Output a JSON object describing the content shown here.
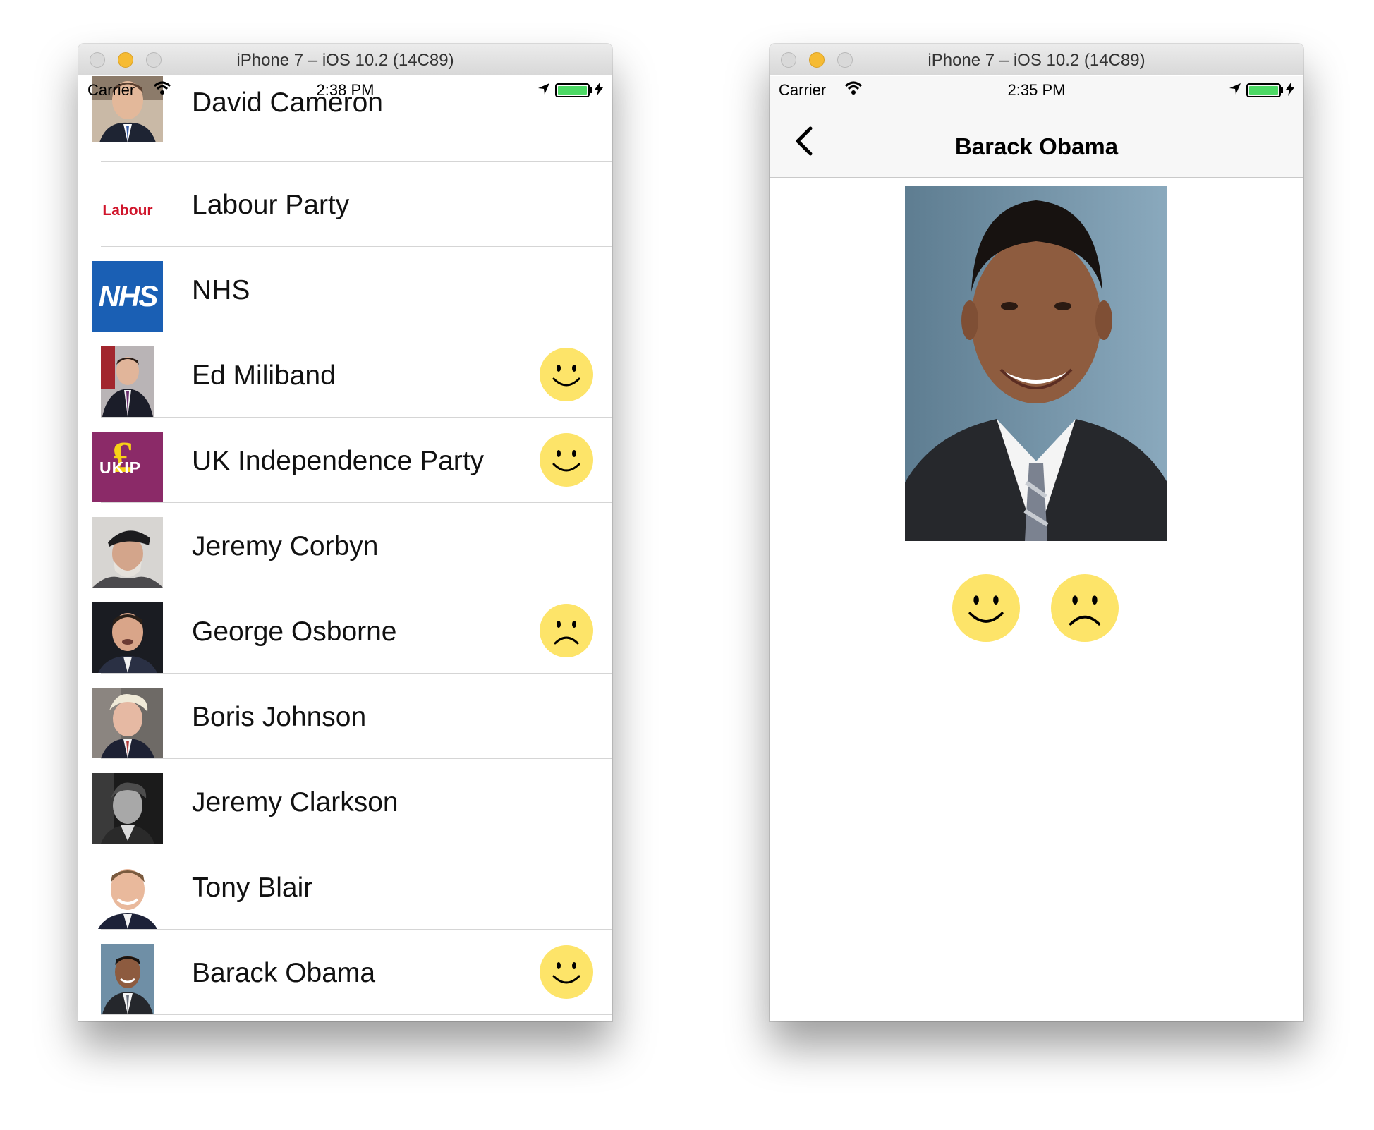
{
  "left_window": {
    "title": "iPhone 7 – iOS 10.2 (14C89)",
    "status": {
      "carrier": "Carrier",
      "time": "2:38 PM"
    },
    "rows": [
      {
        "name": "David Cameron",
        "thumb": "photo",
        "reaction": ""
      },
      {
        "name": "Labour Party",
        "thumb": "labour-logo",
        "logo_text": "Labour",
        "reaction": ""
      },
      {
        "name": "NHS",
        "thumb": "nhs-logo",
        "logo_text": "NHS",
        "reaction": ""
      },
      {
        "name": "Ed Miliband",
        "thumb": "photo",
        "reaction": "happy"
      },
      {
        "name": "UK Independence Party",
        "thumb": "ukip-logo",
        "logo_text": "UKIP",
        "reaction": "happy"
      },
      {
        "name": "Jeremy Corbyn",
        "thumb": "photo",
        "reaction": ""
      },
      {
        "name": "George Osborne",
        "thumb": "photo",
        "reaction": "sad"
      },
      {
        "name": "Boris Johnson",
        "thumb": "photo",
        "reaction": ""
      },
      {
        "name": "Jeremy Clarkson",
        "thumb": "photo",
        "reaction": ""
      },
      {
        "name": "Tony Blair",
        "thumb": "photo",
        "reaction": ""
      },
      {
        "name": "Barack Obama",
        "thumb": "photo",
        "reaction": "happy"
      }
    ]
  },
  "right_window": {
    "title": "iPhone 7 – iOS 10.2 (14C89)",
    "status": {
      "carrier": "Carrier",
      "time": "2:35 PM"
    },
    "nav_title": "Barack Obama"
  },
  "colors": {
    "smiley_fill": "#fde469",
    "nhs_blue": "#1a5fb4",
    "ukip_purple": "#8b2a68",
    "ukip_yellow": "#f7d117",
    "labour_red": "#d0152b",
    "battery_green": "#4cd964"
  },
  "icons": [
    "wifi-icon",
    "location-arrow-icon",
    "battery-icon",
    "charging-bolt-icon",
    "back-chevron-icon",
    "happy-face-icon",
    "sad-face-icon"
  ]
}
